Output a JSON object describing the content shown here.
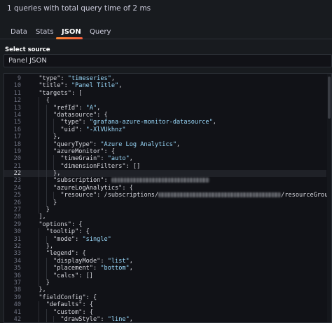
{
  "summary": "1 queries with total query time of 2 ms",
  "tabs": [
    {
      "label": "Data",
      "active": false
    },
    {
      "label": "Stats",
      "active": false
    },
    {
      "label": "JSON",
      "active": true
    },
    {
      "label": "Query",
      "active": false
    }
  ],
  "select_source": {
    "label": "Select source",
    "value": "Panel JSON"
  },
  "editor": {
    "current_line": 22,
    "lines": [
      {
        "n": "9",
        "t": "  \"type\": \"timeseries\","
      },
      {
        "n": "10",
        "t": "  \"title\": \"Panel Title\","
      },
      {
        "n": "11",
        "t": "  \"targets\": ["
      },
      {
        "n": "12",
        "t": "    {"
      },
      {
        "n": "13",
        "t": "      \"refId\": \"A\","
      },
      {
        "n": "14",
        "t": "      \"datasource\": {"
      },
      {
        "n": "15",
        "t": "        \"type\": \"grafana-azure-monitor-datasource\","
      },
      {
        "n": "16",
        "t": "        \"uid\": \"-XlVUkhnz\""
      },
      {
        "n": "17",
        "t": "      },"
      },
      {
        "n": "18",
        "t": "      \"queryType\": \"Azure Log Analytics\","
      },
      {
        "n": "19",
        "t": "      \"azureMonitor\": {"
      },
      {
        "n": "20",
        "t": "        \"timeGrain\": \"auto\","
      },
      {
        "n": "21",
        "t": "        \"dimensionFilters\": []"
      },
      {
        "n": "22",
        "t": "      },"
      },
      {
        "n": "23",
        "t": "      \"subscription\": \"",
        "blurred": true
      },
      {
        "n": "24",
        "t": "      \"azureLogAnalytics\": {"
      },
      {
        "n": "25",
        "t": "        \"resource\": \"/subscriptions/",
        "blurred": true,
        "after": "/resourceGroups/DEV-CoreArc\""
      },
      {
        "n": "26",
        "t": "      }"
      },
      {
        "n": "27",
        "t": "    }"
      },
      {
        "n": "28",
        "t": "  ],"
      },
      {
        "n": "29",
        "t": "  \"options\": {"
      },
      {
        "n": "30",
        "t": "    \"tooltip\": {"
      },
      {
        "n": "31",
        "t": "      \"mode\": \"single\""
      },
      {
        "n": "32",
        "t": "    },"
      },
      {
        "n": "33",
        "t": "    \"legend\": {"
      },
      {
        "n": "34",
        "t": "      \"displayMode\": \"list\","
      },
      {
        "n": "35",
        "t": "      \"placement\": \"bottom\","
      },
      {
        "n": "36",
        "t": "      \"calcs\": []"
      },
      {
        "n": "37",
        "t": "    }"
      },
      {
        "n": "38",
        "t": "  },"
      },
      {
        "n": "39",
        "t": "  \"fieldConfig\": {"
      },
      {
        "n": "40",
        "t": "    \"defaults\": {"
      },
      {
        "n": "41",
        "t": "      \"custom\": {"
      },
      {
        "n": "42",
        "t": "        \"drawStyle\": \"line\","
      }
    ]
  }
}
